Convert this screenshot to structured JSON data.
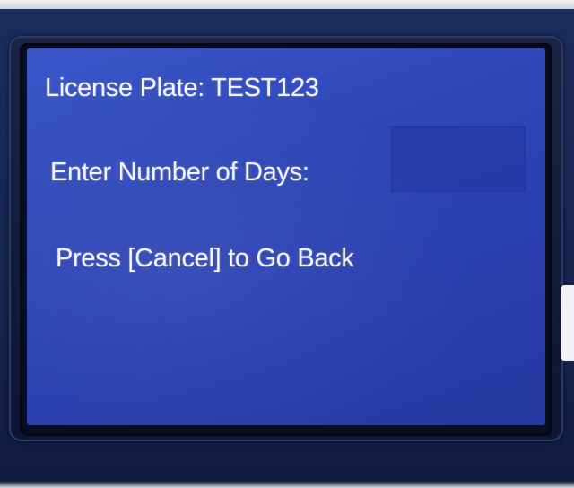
{
  "screen": {
    "license_plate_label": "License Plate: TEST123",
    "days_prompt": "Enter Number of Days:",
    "days_value": "",
    "cancel_instruction": "Press [Cancel] to Go Back"
  },
  "colors": {
    "screen_background": "#2f47b8",
    "text": "#f4f6ff",
    "housing": "#16264f"
  }
}
